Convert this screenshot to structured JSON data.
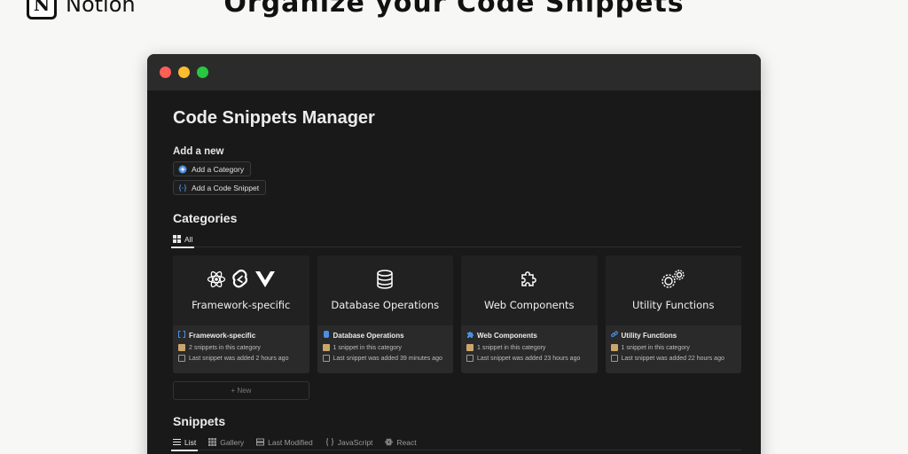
{
  "promo": {
    "brand": "Notion",
    "title": "Organize your Code Snippets"
  },
  "page": {
    "title": "Code Snippets Manager"
  },
  "add_new": {
    "label": "Add a new",
    "buttons": [
      {
        "label": "Add a Category",
        "icon": "plus-circle-icon"
      },
      {
        "label": "Add a Code Snippet",
        "icon": "braces-icon"
      }
    ]
  },
  "categories": {
    "heading": "Categories",
    "tabs": [
      {
        "label": "All",
        "icon": "grid-icon",
        "active": true
      }
    ],
    "cards": [
      {
        "cover": "Framework-specific",
        "title": "Framework-specific",
        "title_icon": "bracket-square-icon",
        "count": "2 snippets in this category",
        "last": "Last snippet was added 2 hours ago"
      },
      {
        "cover": "Database Operations",
        "title": "Database Operations",
        "title_icon": "database-icon",
        "count": "1 snippet in this category",
        "last": "Last snippet was added 39 minutes ago"
      },
      {
        "cover": "Web Components",
        "title": "Web Components",
        "title_icon": "puzzle-icon",
        "count": "1 snippet in this category",
        "last": "Last snippet was added 23 hours ago"
      },
      {
        "cover": "Utility Functions",
        "title": "Utility Functions",
        "title_icon": "link-icon",
        "count": "1 snippet in this category",
        "last": "Last snippet was added 22 hours ago"
      }
    ],
    "new_label": "+ New"
  },
  "snippets": {
    "heading": "Snippets",
    "tabs": [
      {
        "label": "List",
        "icon": "list-icon",
        "active": true
      },
      {
        "label": "Gallery",
        "icon": "gallery-icon",
        "active": false
      },
      {
        "label": "Last Modified",
        "icon": "stack-icon",
        "active": false
      },
      {
        "label": "JavaScript",
        "icon": "braces-icon",
        "active": false
      },
      {
        "label": "React",
        "icon": "react-icon",
        "active": false
      }
    ]
  },
  "colors": {
    "accent_blue": "#4a90e2",
    "folder": "#c9a66b"
  }
}
